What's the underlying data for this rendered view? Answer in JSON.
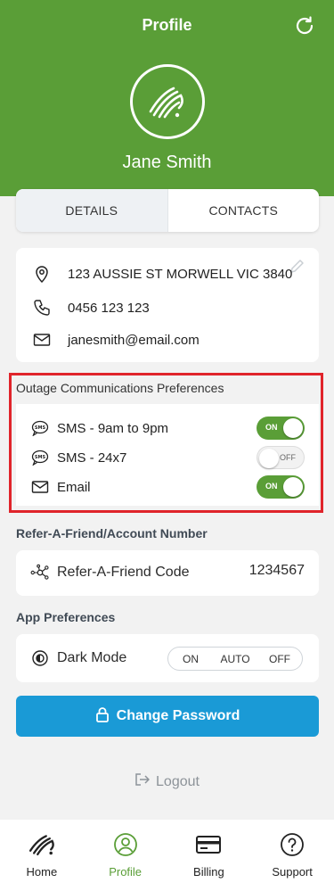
{
  "header": {
    "title": "Profile",
    "user_name": "Jane Smith"
  },
  "tabs": [
    {
      "label": "DETAILS",
      "active": true
    },
    {
      "label": "CONTACTS",
      "active": false
    }
  ],
  "details": {
    "address": "123 AUSSIE ST MORWELL VIC 3840",
    "phone": "0456 123 123",
    "email": "janesmith@email.com"
  },
  "outage_prefs": {
    "title": "Outage Communications Preferences",
    "items": [
      {
        "label": "SMS - 9am to 9pm",
        "state": "ON",
        "icon": "sms-icon"
      },
      {
        "label": "SMS - 24x7",
        "state": "OFF",
        "icon": "sms-icon"
      },
      {
        "label": "Email",
        "state": "ON",
        "icon": "mail-icon"
      }
    ]
  },
  "refer": {
    "section_title": "Refer-A-Friend/Account Number",
    "label": "Refer-A-Friend Code",
    "value": "1234567"
  },
  "app_prefs": {
    "section_title": "App Preferences",
    "dark_mode_label": "Dark Mode",
    "options": [
      "ON",
      "AUTO",
      "OFF"
    ]
  },
  "actions": {
    "change_password": "Change Password",
    "logout": "Logout"
  },
  "nav": [
    {
      "label": "Home",
      "icon": "home-logo-icon"
    },
    {
      "label": "Profile",
      "icon": "profile-icon",
      "active": true
    },
    {
      "label": "Billing",
      "icon": "card-icon"
    },
    {
      "label": "Support",
      "icon": "help-icon"
    }
  ],
  "colors": {
    "brand_green": "#5a9e37",
    "button_blue": "#1a9ad6",
    "highlight_red": "#e0242b"
  }
}
